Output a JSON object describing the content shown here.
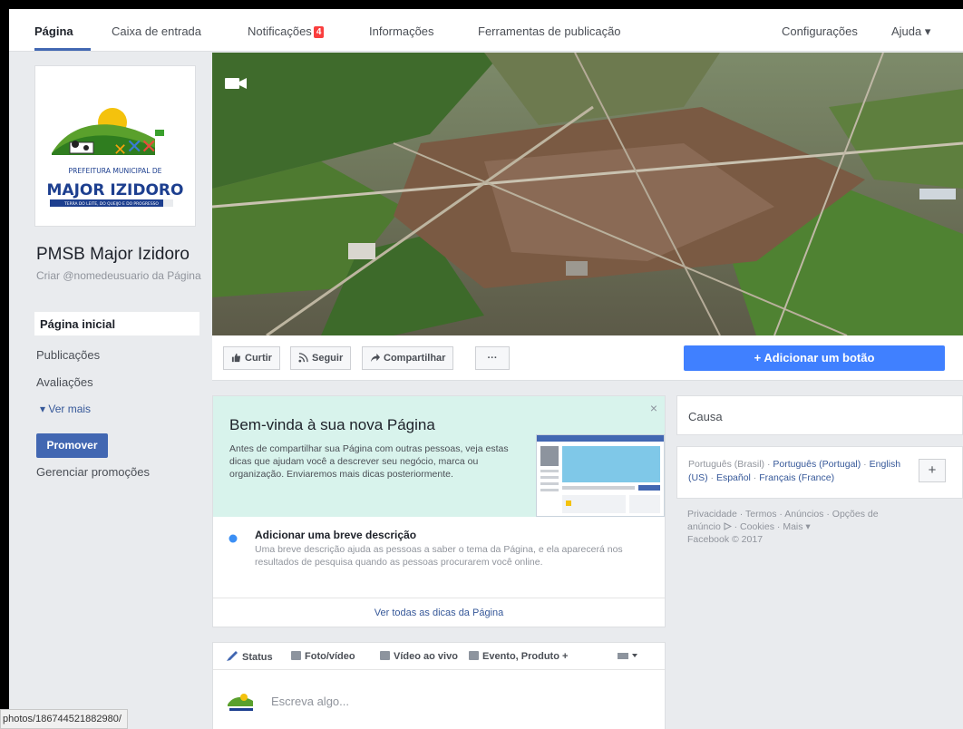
{
  "nav": {
    "items": [
      {
        "label": "Página",
        "active": true
      },
      {
        "label": "Caixa de entrada"
      },
      {
        "label": "Notificações",
        "badge": "4"
      },
      {
        "label": "Informações"
      },
      {
        "label": "Ferramentas de publicação"
      },
      {
        "label": "Configurações"
      },
      {
        "label": "Ajuda ▾"
      }
    ]
  },
  "profile": {
    "logo_line1": "PREFEITURA MUNICIPAL DE",
    "logo_line2": "MAJOR IZIDORO",
    "logo_line3": "TERRA DO LEITE, DO QUEIJO E DO PROGRESSO",
    "page_name": "PMSB Major Izidoro",
    "username": "Criar @nomedeusuario da Página"
  },
  "leftnav": {
    "items": [
      "Página inicial",
      "Publicações",
      "Avaliações"
    ],
    "see_more": "▾ Ver mais",
    "promote": "Promover",
    "manage": "Gerenciar promoções"
  },
  "actions": {
    "like": "Curtir",
    "follow": "Seguir",
    "share": "Compartilhar",
    "more": "···",
    "add_button": "+ Adicionar um botão"
  },
  "welcome": {
    "title": "Bem-vinda à sua nova Página",
    "body": "Antes de compartilhar sua Página com outras pessoas, veja estas dicas que ajudam você a descrever seu negócio, marca ou organização. Enviaremos mais dicas posteriormente.",
    "close": "×",
    "tip_title": "Adicionar uma breve descrição",
    "tip_desc": "Uma breve descrição ajuda as pessoas a saber o tema da Página, e ela aparecerá nos resultados de pesquisa quando as pessoas procurarem você online.",
    "all_tips": "Ver todas as dicas da Página"
  },
  "composer": {
    "tabs": [
      "Status",
      "Foto/vídeo",
      "Vídeo ao vivo",
      "Evento, Produto +"
    ],
    "placeholder": "Escreva algo..."
  },
  "right": {
    "causa": "Causa",
    "languages": [
      "Português (Brasil)",
      "Português (Portugal)",
      "English (US)",
      "Español",
      "Français (France)"
    ],
    "lang_add": "+",
    "footer": [
      "Privacidade",
      "Termos",
      "Anúncios",
      "Opções de anúncio",
      "Cookies",
      "Mais",
      "Facebook © 2017"
    ]
  },
  "statusbar": {
    "url": "photos/186744521882980/"
  },
  "colors": {
    "brand": "#4267b2",
    "cta": "#4080ff",
    "welcome_bg": "#d8f3ec",
    "badge": "#fa3e3e"
  }
}
